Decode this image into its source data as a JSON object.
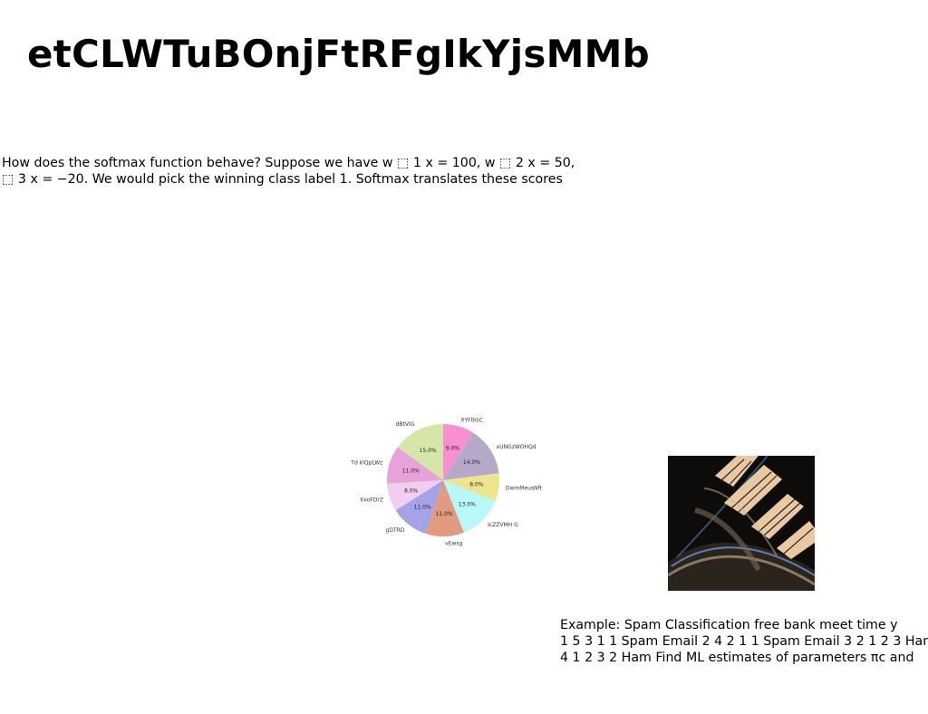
{
  "document": {
    "title": "etCLWTuBOnjFtRFgIkYjsMMb",
    "paragraph_1": [
      "How does the softmax function behave? Suppose we have w ⬚ 1 x = 100, w ⬚ 2 x = 50,",
      "⬚ 3 x = −20. We would pick the winning class label 1. Softmax translates these scores"
    ],
    "paragraph_2": [
      "Example: Spam Classification free bank meet time y",
      "1 5 3 1 1 Spam Email 2 4 2 1 1 Spam Email 3 2 1 2 3 Ham",
      "4 1 2 3 2 Ham Find ML estimates of parameters πc and"
    ]
  },
  "chart_data": {
    "type": "pie",
    "title": "",
    "slices": [
      {
        "label": "XYFlbSC",
        "value": 9.0,
        "pct_label": "9.0%",
        "color": "#f78fd1"
      },
      {
        "label": "xUNGzWOHQd",
        "value": 14.0,
        "pct_label": "14.0%",
        "color": "#b5a9c9"
      },
      {
        "label": "DwmMeusNft",
        "value": 8.0,
        "pct_label": "8.0%",
        "color": "#efe48e"
      },
      {
        "label": "IcZZVMH G",
        "value": 13.0,
        "pct_label": "13.0%",
        "color": "#b8f9f7"
      },
      {
        "label": "vEwsg",
        "value": 11.0,
        "pct_label": "11.0%",
        "color": "#e29a80"
      },
      {
        "label": "gDTRD",
        "value": 11.0,
        "pct_label": "11.0%",
        "color": "#a6a2e8"
      },
      {
        "label": "XxoFDrZ",
        "value": 8.0,
        "pct_label": "8.0%",
        "color": "#f1cdef"
      },
      {
        "label": "Td kIQpLWz",
        "value": 11.0,
        "pct_label": "11.0%",
        "color": "#e7a2d9"
      },
      {
        "label": "dBtVIG",
        "value": 15.0,
        "pct_label": "15.0%",
        "color": "#d4e6a8"
      }
    ],
    "start_angle_deg": 90,
    "direction": "clockwise"
  },
  "photo": {
    "description_icon": "architecture-photo",
    "colors": {
      "dark": "#0d0c0a",
      "light": "#e9c9a4",
      "blue": "#5d80b2"
    }
  }
}
